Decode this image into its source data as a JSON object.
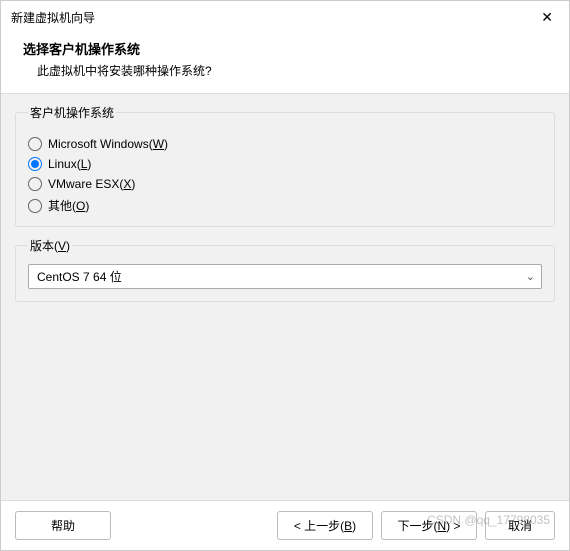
{
  "titlebar": {
    "title": "新建虚拟机向导"
  },
  "header": {
    "title": "选择客户机操作系统",
    "subtitle": "此虚拟机中将安装哪种操作系统?"
  },
  "os_group": {
    "legend": "客户机操作系统",
    "options": {
      "windows": {
        "text": "Microsoft Windows(",
        "mnemonic": "W",
        "suffix": ")"
      },
      "linux": {
        "text": "Linux(",
        "mnemonic": "L",
        "suffix": ")"
      },
      "esx": {
        "text": "VMware ESX(",
        "mnemonic": "X",
        "suffix": ")"
      },
      "other": {
        "text": "其他(",
        "mnemonic": "O",
        "suffix": ")"
      }
    },
    "selected": "linux"
  },
  "version": {
    "legend_pre": "版本(",
    "legend_m": "V",
    "legend_suf": ")",
    "selected": "CentOS 7 64 位"
  },
  "footer": {
    "help": "帮助",
    "back_pre": "< 上一步(",
    "back_m": "B",
    "back_suf": ")",
    "next_pre": "下一步(",
    "next_m": "N",
    "next_suf": ") >",
    "cancel": "取消"
  },
  "watermark": "CSDN @qq_17798035"
}
